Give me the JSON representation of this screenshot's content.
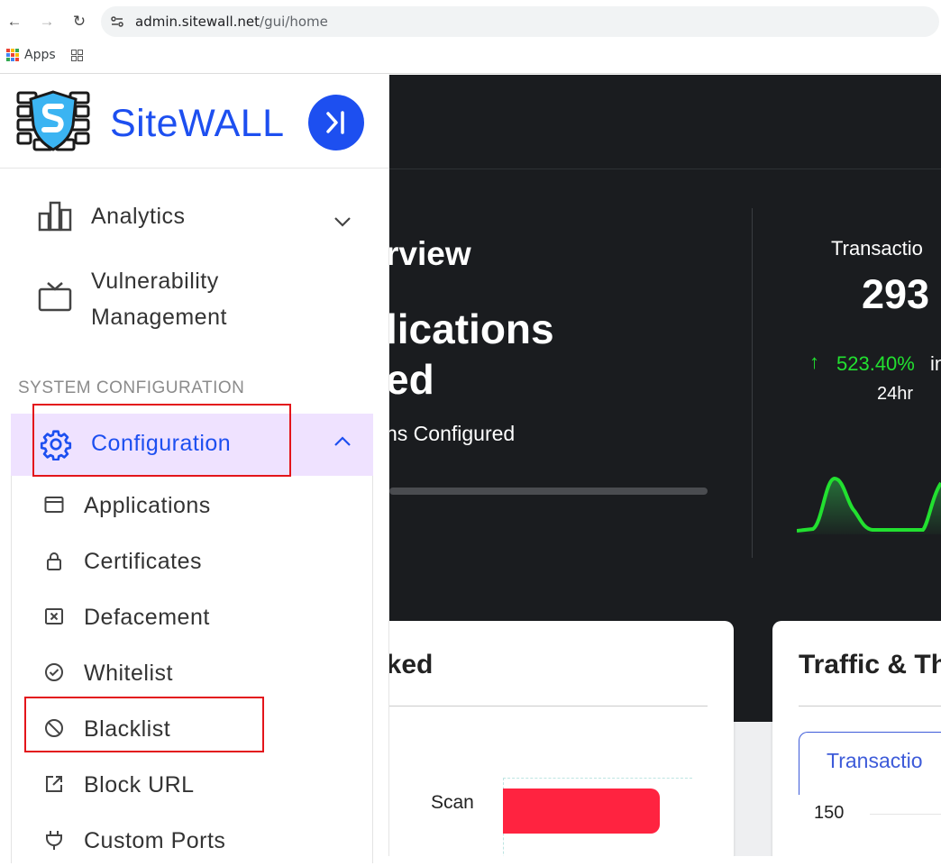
{
  "browser": {
    "url_host": "admin.sitewall.net",
    "url_path": "/gui/home",
    "bookmarks_label": "Apps"
  },
  "sidebar": {
    "brand": "SiteWALL",
    "items": [
      {
        "label": "Analytics"
      },
      {
        "label_line1": "Vulnerability",
        "label_line2": "Management"
      }
    ],
    "section_label": "SYSTEM CONFIGURATION",
    "config_label": "Configuration",
    "sub_items": [
      {
        "label": "Applications",
        "icon": "window-icon"
      },
      {
        "label": "Certificates",
        "icon": "lock-icon"
      },
      {
        "label": "Defacement",
        "icon": "close-box-icon"
      },
      {
        "label": "Whitelist",
        "icon": "check-circle-icon"
      },
      {
        "label": "Blacklist",
        "icon": "block-icon"
      },
      {
        "label": "Block URL",
        "icon": "external-link-icon"
      },
      {
        "label": "Custom Ports",
        "icon": "plug-icon"
      }
    ]
  },
  "main": {
    "overview_title": "rview",
    "overview_big_line1": "lications",
    "overview_big_line2": "ed",
    "overview_sub": "ns Configured",
    "transactions_label": "Transactio",
    "transactions_value": "293",
    "change_arrow": "↑",
    "change_pct": "523.40%",
    "change_suffix": "in",
    "change_period": "24hr",
    "card1_title": "cked",
    "card1_bar_label": "Scan",
    "card2_title": "Traffic & Th",
    "card2_tab": "Transactio",
    "card2_axis_tick": "150"
  },
  "colors": {
    "accent": "#1d4ff0",
    "active_bg": "#efe2ff",
    "danger": "#ff2340",
    "positive": "#22e030"
  }
}
